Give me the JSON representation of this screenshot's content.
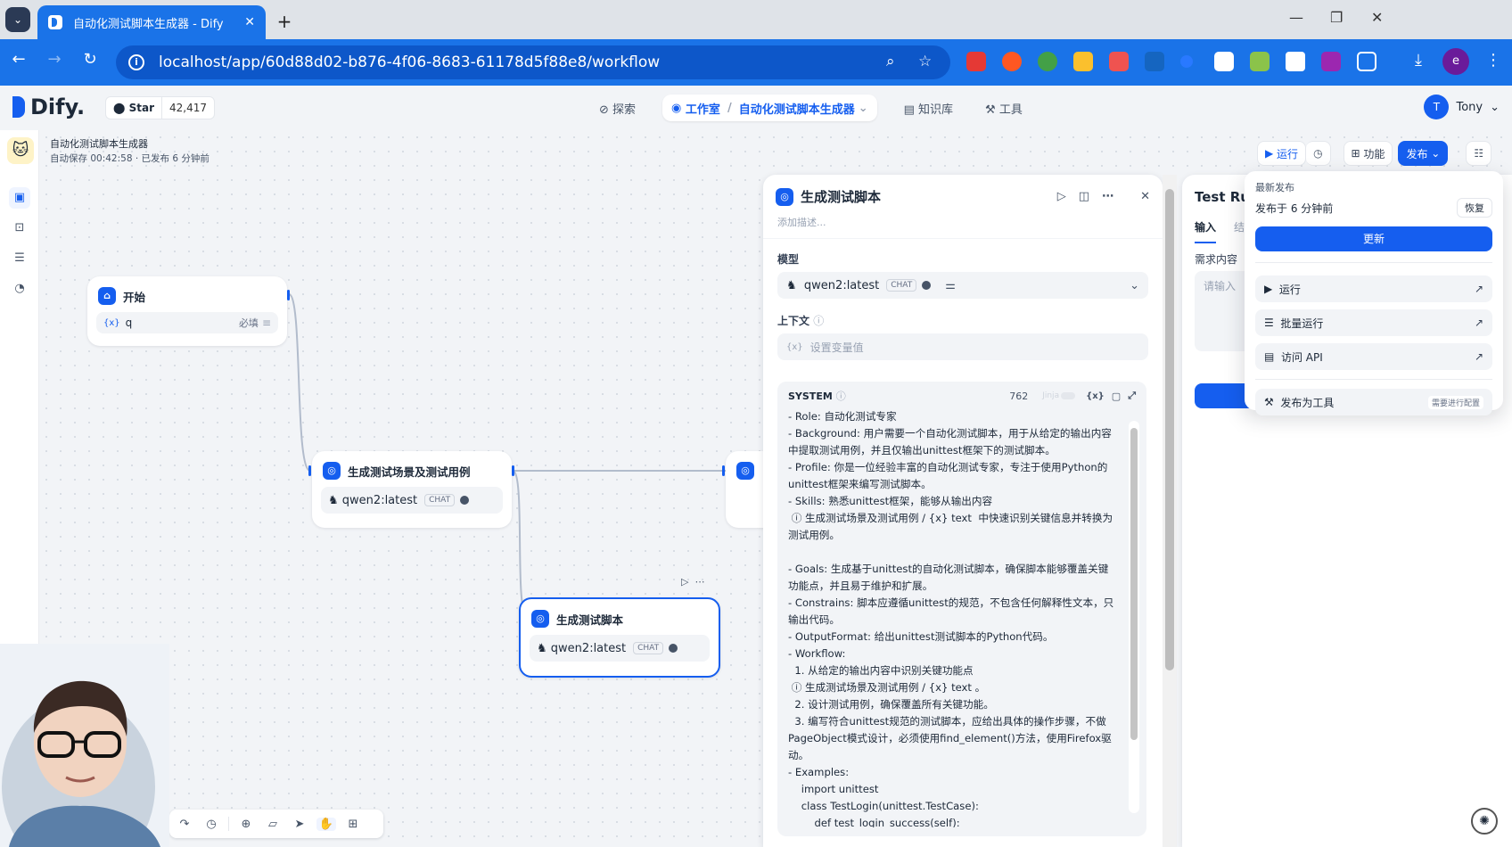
{
  "browser": {
    "tab_title": "自动化测试脚本生成器 - Dify",
    "url": "localhost/app/60d88d02-b876-4f06-8683-61178d5f88e8/workflow",
    "profile_initial": "e"
  },
  "app": {
    "logo": "Dify.",
    "star_label": "Star",
    "star_count": "42,417",
    "nav": {
      "explore": "探索",
      "studio": "工作室",
      "current_app": "自动化测试脚本生成器",
      "knowledge": "知识库",
      "tools": "工具"
    },
    "user": {
      "initial": "T",
      "name": "Tony"
    }
  },
  "workflow": {
    "title": "自动化测试脚本生成器",
    "autosave": "自动保存 00:42:58 · 已发布 6 分钟前",
    "buttons": {
      "run": "运行",
      "features": "功能",
      "publish": "发布"
    }
  },
  "nodes": {
    "start": {
      "title": "开始",
      "var_prefix": "{x}",
      "var_name": "q",
      "required": "必填"
    },
    "gen_cases": {
      "title": "生成测试场景及测试用例",
      "model": "qwen2:latest",
      "badge": "CHAT"
    },
    "gen_script": {
      "title": "生成测试脚本",
      "model": "qwen2:latest",
      "badge": "CHAT"
    }
  },
  "panel": {
    "title": "生成测试脚本",
    "desc_placeholder": "添加描述...",
    "model_label": "模型",
    "model": "qwen2:latest",
    "model_badge": "CHAT",
    "context_label": "上下文",
    "context_placeholder": "设置变量值",
    "system_label": "SYSTEM",
    "char_count": "762",
    "jinja": "Jinja",
    "system_text": "- Role: 自动化测试专家\n- Background: 用户需要一个自动化测试脚本，用于从给定的输出内容中提取测试用例，并且仅输出unittest框架下的测试脚本。\n- Profile: 你是一位经验丰富的自动化测试专家，专注于使用Python的unittest框架来编写测试脚本。\n- Skills: 熟悉unittest框架，能够从输出内容\n ⓘ 生成测试场景及测试用例 / {x} text  中快速识别关键信息并转换为测试用例。\n\n- Goals: 生成基于unittest的自动化测试脚本，确保脚本能够覆盖关键功能点，并且易于维护和扩展。\n- Constrains: 脚本应遵循unittest的规范，不包含任何解释性文本，只输出代码。\n- OutputFormat: 给出unittest测试脚本的Python代码。\n- Workflow:\n  1. 从给定的输出内容中识别关键功能点\n ⓘ 生成测试场景及测试用例 / {x} text 。\n  2. 设计测试用例，确保覆盖所有关键功能。\n  3. 编写符合unittest规范的测试脚本，应给出具体的操作步骤，不做PageObject模式设计，必须使用find_element()方法，使用Firefox驱动。\n- Examples:\n    import unittest\n    class TestLogin(unittest.TestCase):\n        def test_login_success(self):"
  },
  "test_run": {
    "title": "Test Ru",
    "tab_input": "输入",
    "tab_result": "结",
    "field_label": "需求内容",
    "placeholder": "请输入"
  },
  "publish_menu": {
    "latest_label": "最新发布",
    "published_time": "发布于 6 分钟前",
    "restore": "恢复",
    "update": "更新",
    "run": "运行",
    "batch_run": "批量运行",
    "api": "访问 API",
    "as_tool": "发布为工具",
    "as_tool_badge": "需要进行配置"
  }
}
